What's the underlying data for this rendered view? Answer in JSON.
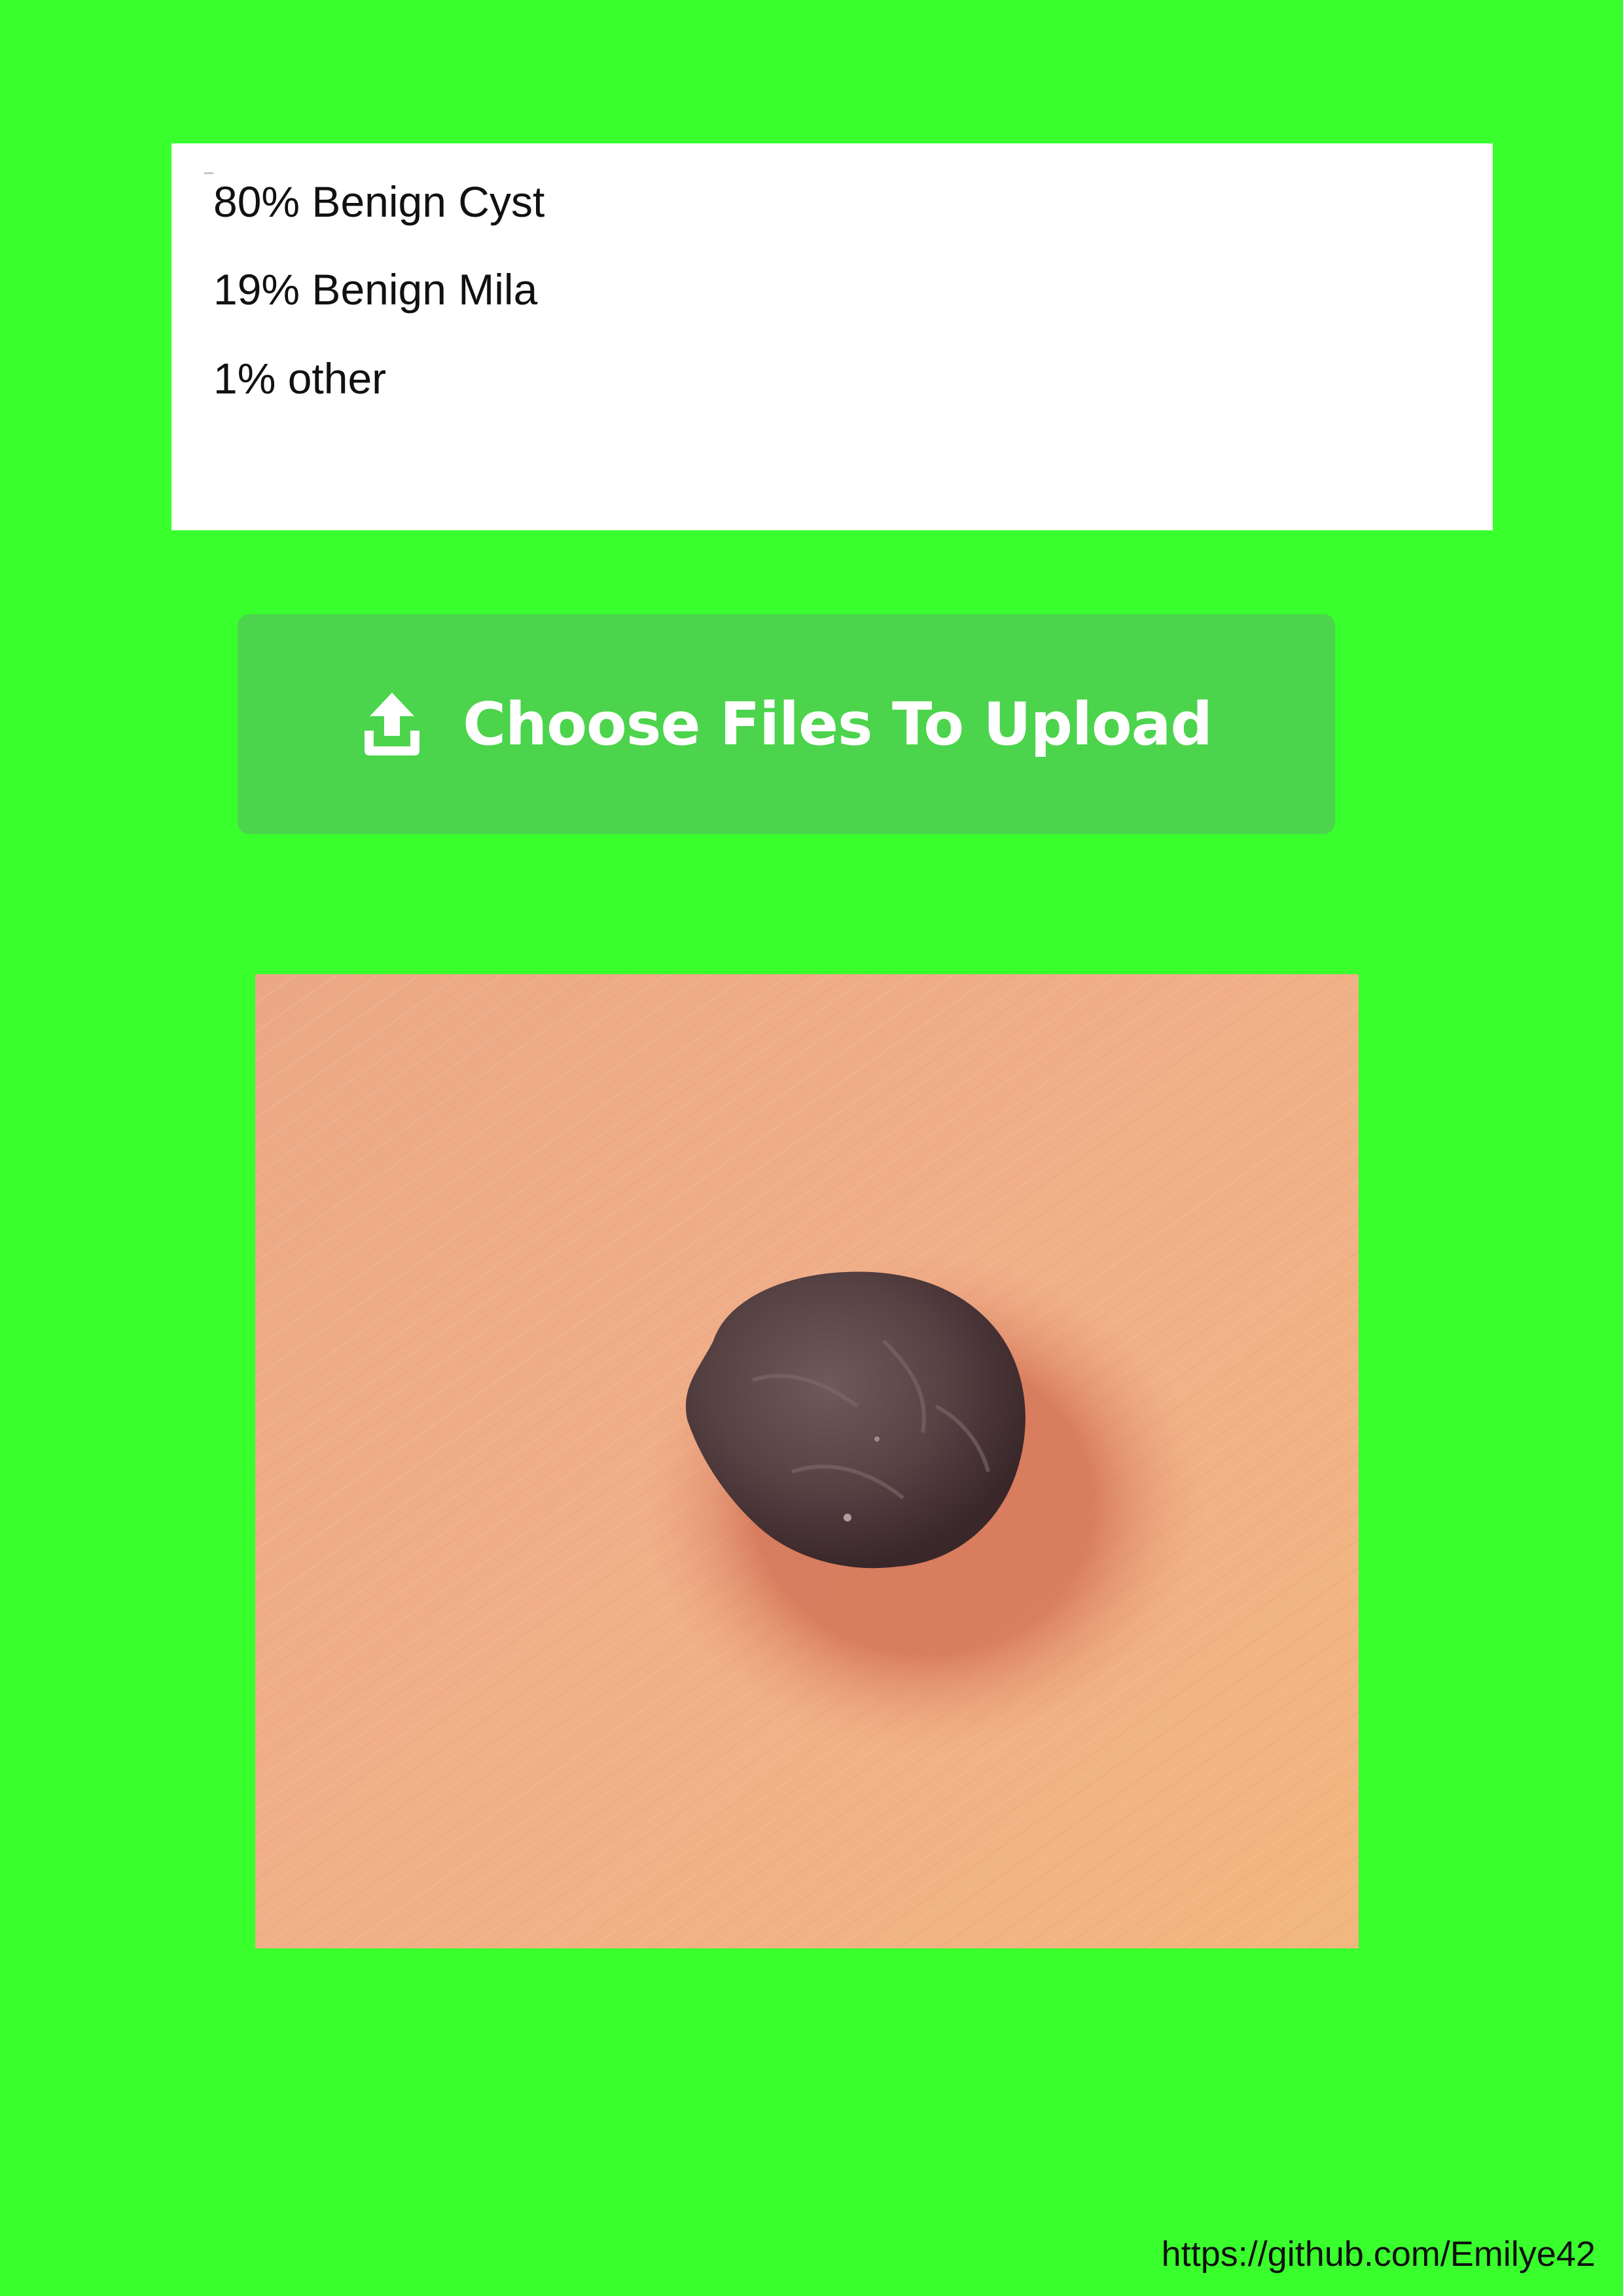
{
  "results": [
    {
      "text": "80% Benign Cyst"
    },
    {
      "text": "19% Benign Mila"
    },
    {
      "text": "1% other"
    }
  ],
  "upload_button": {
    "label": "Choose Files To Upload",
    "icon": "upload-icon"
  },
  "image": {
    "subject": "skin-lesion-photo"
  },
  "footer": {
    "link_text": "https://github.com/Emilye42"
  },
  "colors": {
    "background": "#39ff2d",
    "button": "#4bd44c",
    "panel": "#ffffff",
    "text": "#111111"
  }
}
